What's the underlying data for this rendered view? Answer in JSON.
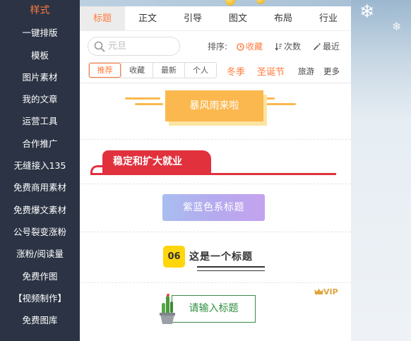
{
  "sidebar": {
    "items": [
      {
        "label": "样式",
        "active": true
      },
      {
        "label": "一键排版"
      },
      {
        "label": "模板"
      },
      {
        "label": "图片素材"
      },
      {
        "label": "我的文章"
      },
      {
        "label": "运营工具"
      },
      {
        "label": "合作推广"
      },
      {
        "label": "无缝接入135"
      },
      {
        "label": "免费商用素材"
      },
      {
        "label": "免费爆文素材"
      },
      {
        "label": "公号裂变涨粉"
      },
      {
        "label": "涨粉/阅读量"
      },
      {
        "label": "免费作图"
      },
      {
        "label": "【视频制作】"
      },
      {
        "label": "免费图库"
      }
    ]
  },
  "tabs": [
    {
      "label": "标题",
      "active": true
    },
    {
      "label": "正文"
    },
    {
      "label": "引导"
    },
    {
      "label": "图文"
    },
    {
      "label": "布局"
    },
    {
      "label": "行业"
    }
  ],
  "search": {
    "placeholder": "元旦",
    "value": ""
  },
  "sort": {
    "label": "排序:",
    "options": [
      {
        "label": "收藏",
        "icon": "clock-icon",
        "active": true
      },
      {
        "label": "次数",
        "icon": "sort-icon"
      },
      {
        "label": "最近",
        "icon": "magic-wand-icon"
      }
    ]
  },
  "filters": {
    "segments": [
      {
        "label": "推荐",
        "active": true
      },
      {
        "label": "收藏"
      },
      {
        "label": "最新"
      },
      {
        "label": "个人"
      }
    ],
    "tags": [
      "冬季",
      "圣诞节",
      "旅游",
      "更多"
    ]
  },
  "styles": [
    {
      "type": "banner-orange",
      "text": "暴风雨来啦"
    },
    {
      "type": "red-tab",
      "text": "稳定和扩大就业"
    },
    {
      "type": "purple-gradient",
      "text": "紫蓝色系标题"
    },
    {
      "type": "numbered",
      "number": "06",
      "text": "这是一个标题"
    },
    {
      "type": "plant-box",
      "text": "请输入标题",
      "badge": "VIP"
    }
  ],
  "colors": {
    "accent": "#ff7a3c",
    "sidebar_bg": "#2b3344",
    "banner_orange": "#fbb84f",
    "title_red": "#e0313d",
    "number_yellow": "#ffd60a",
    "plant_green": "#2f8f40"
  }
}
